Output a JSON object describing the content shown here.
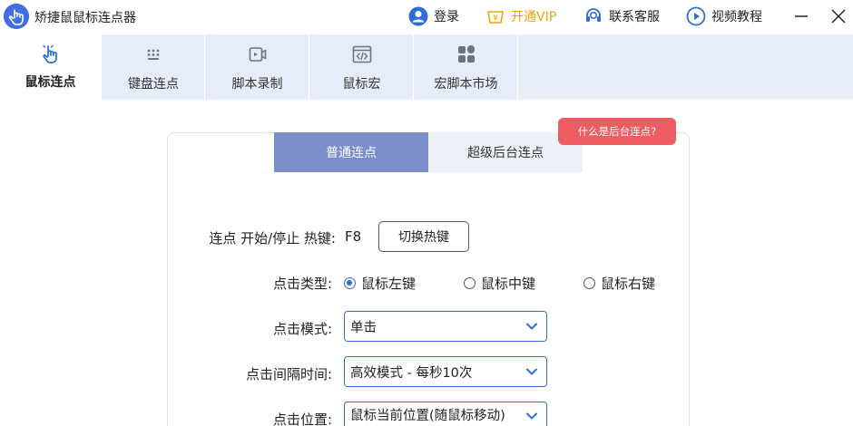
{
  "window": {
    "title": "矫捷鼠鼠标连点器"
  },
  "titlebar": {
    "login": "登录",
    "vip": "开通VIP",
    "support": "联系客服",
    "tutorial": "视频教程"
  },
  "tabs": [
    {
      "label": "鼠标连点",
      "icon": "pointer-hand-icon",
      "active": true
    },
    {
      "label": "键盘连点",
      "icon": "keyboard-icon",
      "active": false
    },
    {
      "label": "脚本录制",
      "icon": "record-icon",
      "active": false
    },
    {
      "label": "鼠标宏",
      "icon": "code-window-icon",
      "active": false
    },
    {
      "label": "宏脚本市场",
      "icon": "grid-app-icon",
      "active": false
    }
  ],
  "subtabs": {
    "normal": "普通连点",
    "super": "超级后台连点"
  },
  "help_badge": "什么是后台连点?",
  "form": {
    "hotkey_label": "连点 开始/停止 热键:",
    "hotkey_value": "F8",
    "hotkey_button": "切换热键",
    "click_type_label": "点击类型:",
    "click_type_options": [
      "鼠标左键",
      "鼠标中键",
      "鼠标右键"
    ],
    "click_type_selected": "鼠标左键",
    "click_mode_label": "点击模式:",
    "click_mode_value": "单击",
    "interval_label": "点击间隔时间:",
    "interval_value": "高效模式 - 每秒10次",
    "position_label": "点击位置:",
    "position_value": "鼠标当前位置(随鼠标移动)"
  },
  "colors": {
    "accent": "#2f6fd4",
    "vip": "#e8a310",
    "badge": "#ec5d63",
    "subtab_active": "#7b8ec9"
  }
}
